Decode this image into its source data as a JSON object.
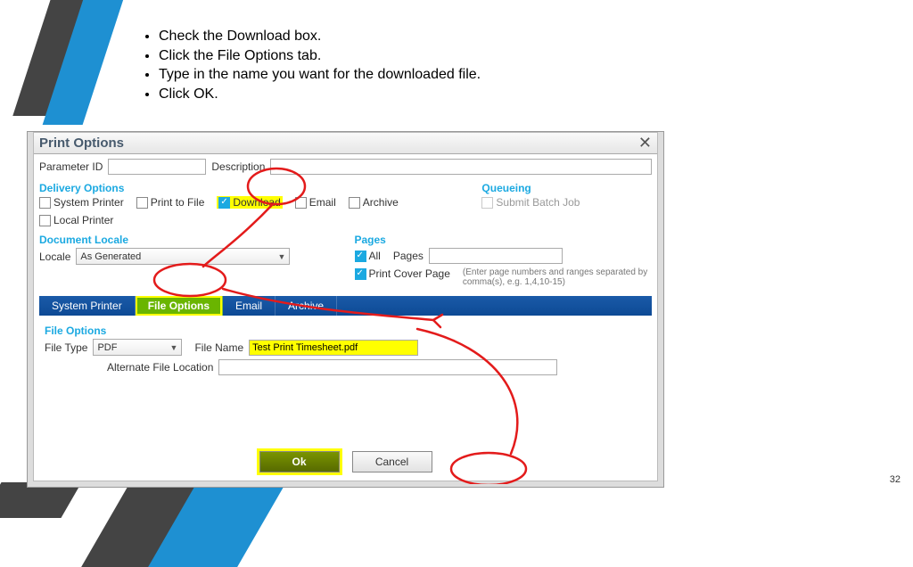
{
  "instructions": {
    "items": [
      "Check the Download box.",
      "Click the File Options tab.",
      "Type in the name you want for the downloaded file.",
      "Click OK."
    ]
  },
  "dialog": {
    "title": "Print Options",
    "close_label": "✕",
    "parameter": {
      "id_label": "Parameter ID",
      "desc_label": "Description"
    },
    "delivery": {
      "title": "Delivery Options",
      "system_printer": "System Printer",
      "print_to_file": "Print to File",
      "download": "Download",
      "email": "Email",
      "archive": "Archive",
      "local_printer": "Local Printer"
    },
    "queueing": {
      "title": "Queueing",
      "submit_batch_job": "Submit Batch Job"
    },
    "document_locale": {
      "title": "Document Locale",
      "locale_label": "Locale",
      "locale_value": "As Generated"
    },
    "pages": {
      "title": "Pages",
      "all": "All",
      "pages_label": "Pages",
      "print_cover_page": "Print Cover Page",
      "hint": "(Enter page numbers and ranges separated by comma(s), e.g. 1,4,10-15)"
    },
    "tabs": {
      "system_printer": "System Printer",
      "file_options": "File Options",
      "email": "Email",
      "archive": "Archive"
    },
    "file_options": {
      "title": "File Options",
      "file_type_label": "File Type",
      "file_type_value": "PDF",
      "file_name_label": "File Name",
      "file_name_value": "Test Print Timesheet.pdf",
      "alt_loc_label": "Alternate File Location"
    },
    "buttons": {
      "ok": "Ok",
      "cancel": "Cancel"
    }
  },
  "page_number": "32"
}
